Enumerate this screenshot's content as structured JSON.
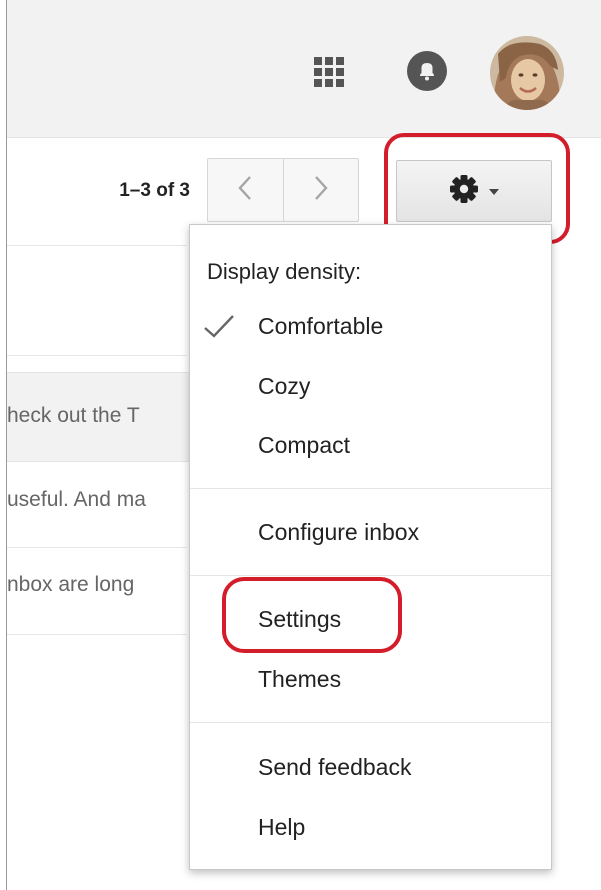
{
  "topbar": {
    "icons": [
      "apps-grid-icon",
      "notifications-icon",
      "avatar"
    ]
  },
  "toolbar": {
    "pagination": "1–3 of 3",
    "prev_icon": "chevron-left-icon",
    "next_icon": "chevron-right-icon",
    "settings_icon": "gear-icon",
    "dropdown_icon": "caret-down-icon",
    "highlight_color": "#d41d2a"
  },
  "email_list": {
    "snippets": [
      "heck out the T",
      "useful. And ma",
      "nbox are long"
    ]
  },
  "settings_menu": {
    "density_label": "Display density:",
    "density_selected": "Comfortable",
    "items": {
      "comfortable": "Comfortable",
      "cozy": "Cozy",
      "compact": "Compact",
      "configure_inbox": "Configure inbox",
      "settings": "Settings",
      "themes": "Themes",
      "send_feedback": "Send feedback",
      "help": "Help"
    }
  }
}
